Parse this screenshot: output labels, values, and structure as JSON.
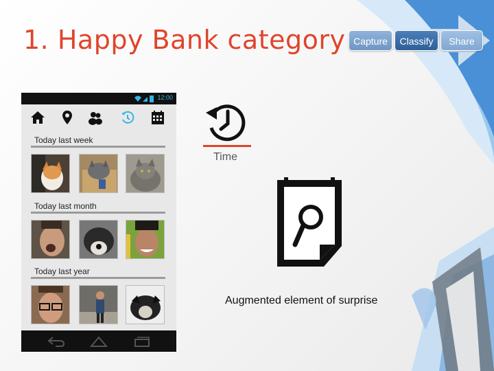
{
  "slide": {
    "title": "1. Happy Bank category"
  },
  "steps": {
    "capture": "Capture",
    "classify": "Classify",
    "share": "Share"
  },
  "phone": {
    "status_time": "12:00",
    "nav_icons": [
      "home-icon",
      "location-pin-icon",
      "people-icon",
      "history-clock-icon",
      "calendar-icon"
    ],
    "active_nav": "history-clock-icon",
    "sections": [
      {
        "label": "Today last week"
      },
      {
        "label": "Today last month"
      },
      {
        "label": "Today last year"
      }
    ],
    "bottom_icons": [
      "back-icon",
      "home-outline-icon",
      "recent-apps-icon"
    ],
    "accent_color": "#33b5e5"
  },
  "time_feature": {
    "label": "Time",
    "underline_color": "#e0442b"
  },
  "surprise": {
    "caption": "Augmented element of surprise"
  },
  "colors": {
    "title": "#e0442b",
    "step_active": "#2f5f98",
    "step_inactive": "#7fa5cf"
  }
}
